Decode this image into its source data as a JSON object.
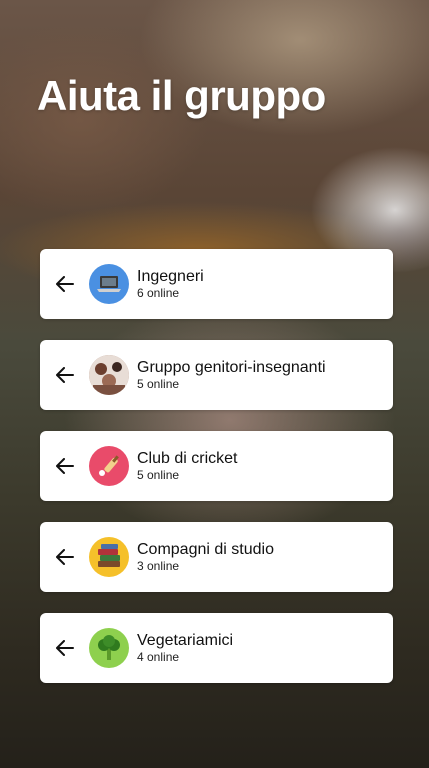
{
  "page": {
    "title": "Aiuta il gruppo"
  },
  "groups": [
    {
      "name": "Ingegneri",
      "status": "6 online",
      "icon": "laptop-icon",
      "color": "#4a90e2"
    },
    {
      "name": "Gruppo genitori-insegnanti",
      "status": "5 online",
      "icon": "group-photo-icon",
      "color": "#b08a78"
    },
    {
      "name": "Club di cricket",
      "status": "5 online",
      "icon": "cricket-bat-icon",
      "color": "#e94b6a"
    },
    {
      "name": "Compagni di studio",
      "status": "3 online",
      "icon": "books-icon",
      "color": "#f5c02a"
    },
    {
      "name": "Vegetariamici",
      "status": "4 online",
      "icon": "broccoli-icon",
      "color": "#8ed04e"
    }
  ]
}
